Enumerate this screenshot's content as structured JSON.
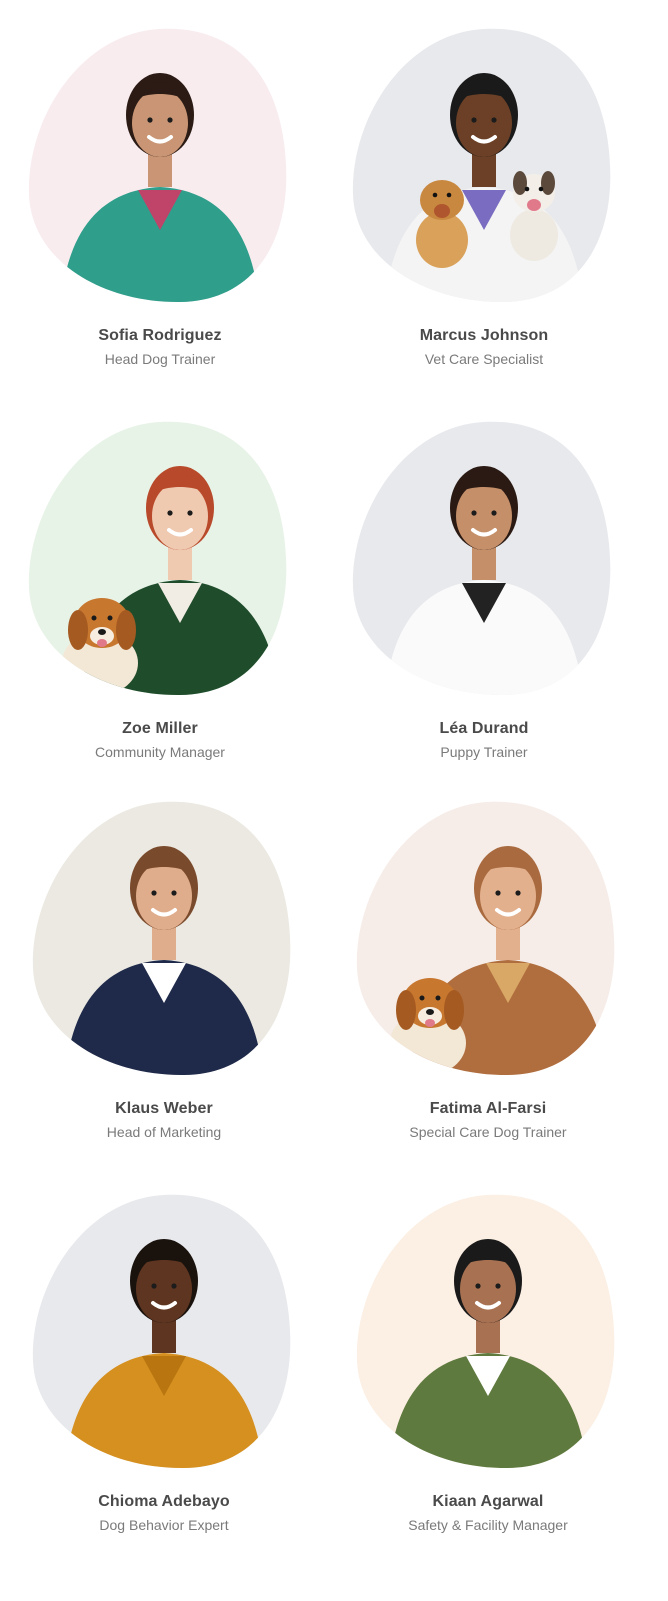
{
  "members": [
    {
      "name": "Sofia Rodriguez",
      "role": "Head Dog Trainer",
      "bg": "#f8ecef",
      "skin": "#c99574",
      "hair": "#2b1b14",
      "outfit": "#2f9e8b",
      "accent": "#c0436a",
      "pet": "none"
    },
    {
      "name": "Marcus Johnson",
      "role": "Vet Care Specialist",
      "bg": "#e8e9ed",
      "skin": "#6b4026",
      "hair": "#1a1a1a",
      "outfit": "#f4f4f4",
      "accent": "#7a6cc0",
      "pet": "two-dogs"
    },
    {
      "name": "Zoe Miller",
      "role": "Community Manager",
      "bg": "#e8f3e8",
      "skin": "#efc9b0",
      "hair": "#b8492a",
      "outfit": "#1f4d2b",
      "accent": "#f1ece4",
      "pet": "dog"
    },
    {
      "name": "Léa Durand",
      "role": "Puppy Trainer",
      "bg": "#e8e9ed",
      "skin": "#c58f6a",
      "hair": "#2a1a13",
      "outfit": "#fafafa",
      "accent": "#222222",
      "pet": "none"
    },
    {
      "name": "Klaus Weber",
      "role": "Head of Marketing",
      "bg": "#ebe9e1",
      "skin": "#e0ad8c",
      "hair": "#7a4a2c",
      "outfit": "#1f2a4a",
      "accent": "#ffffff",
      "pet": "none"
    },
    {
      "name": "Fatima Al-Farsi",
      "role": "Special Care Dog Trainer",
      "bg": "#f6ece8",
      "skin": "#e3b08e",
      "hair": "#a86a3e",
      "outfit": "#b06e3e",
      "accent": "#d9a766",
      "pet": "dog"
    },
    {
      "name": "Chioma Adebayo",
      "role": "Dog Behavior Expert",
      "bg": "#e8e9ed",
      "skin": "#5e3520",
      "hair": "#1a120d",
      "outfit": "#d6901f",
      "accent": "#b87510",
      "pet": "none"
    },
    {
      "name": "Kiaan Agarwal",
      "role": "Safety & Facility Manager",
      "bg": "#fcefe3",
      "skin": "#a87152",
      "hair": "#1a1a1a",
      "outfit": "#5f7a3f",
      "accent": "#ffffff",
      "pet": "none"
    }
  ]
}
